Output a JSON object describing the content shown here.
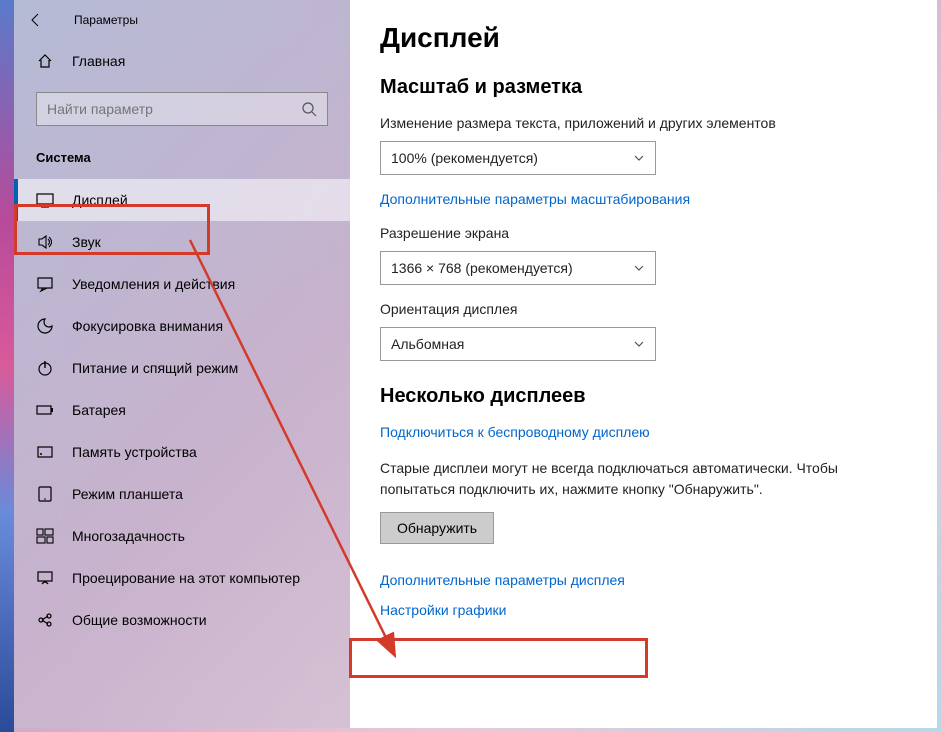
{
  "window": {
    "title": "Параметры"
  },
  "home": {
    "label": "Главная"
  },
  "search": {
    "placeholder": "Найти параметр"
  },
  "section": {
    "system": "Система"
  },
  "nav": {
    "items": [
      {
        "label": "Дисплей",
        "icon": "display-icon",
        "active": true
      },
      {
        "label": "Звук",
        "icon": "sound-icon"
      },
      {
        "label": "Уведомления и действия",
        "icon": "notifications-icon"
      },
      {
        "label": "Фокусировка внимания",
        "icon": "focus-icon"
      },
      {
        "label": "Питание и спящий режим",
        "icon": "power-icon"
      },
      {
        "label": "Батарея",
        "icon": "battery-icon"
      },
      {
        "label": "Память устройства",
        "icon": "storage-icon"
      },
      {
        "label": "Режим планшета",
        "icon": "tablet-icon"
      },
      {
        "label": "Многозадачность",
        "icon": "multitasking-icon"
      },
      {
        "label": "Проецирование на этот компьютер",
        "icon": "projecting-icon"
      },
      {
        "label": "Общие возможности",
        "icon": "shared-icon"
      }
    ]
  },
  "main": {
    "title": "Дисплей",
    "scale": {
      "heading": "Масштаб и разметка",
      "size_label": "Изменение размера текста, приложений и других элементов",
      "size_value": "100% (рекомендуется)",
      "advanced_link": "Дополнительные параметры масштабирования",
      "resolution_label": "Разрешение экрана",
      "resolution_value": "1366 × 768 (рекомендуется)",
      "orientation_label": "Ориентация дисплея",
      "orientation_value": "Альбомная"
    },
    "multi": {
      "heading": "Несколько дисплеев",
      "wireless_link": "Подключиться к беспроводному дисплею",
      "detect_help": "Старые дисплеи могут не всегда подключаться автоматически. Чтобы попытаться подключить их, нажмите кнопку \"Обнаружить\".",
      "detect_btn": "Обнаружить",
      "advanced_link": "Дополнительные параметры дисплея",
      "graphics_link": "Настройки графики"
    }
  }
}
